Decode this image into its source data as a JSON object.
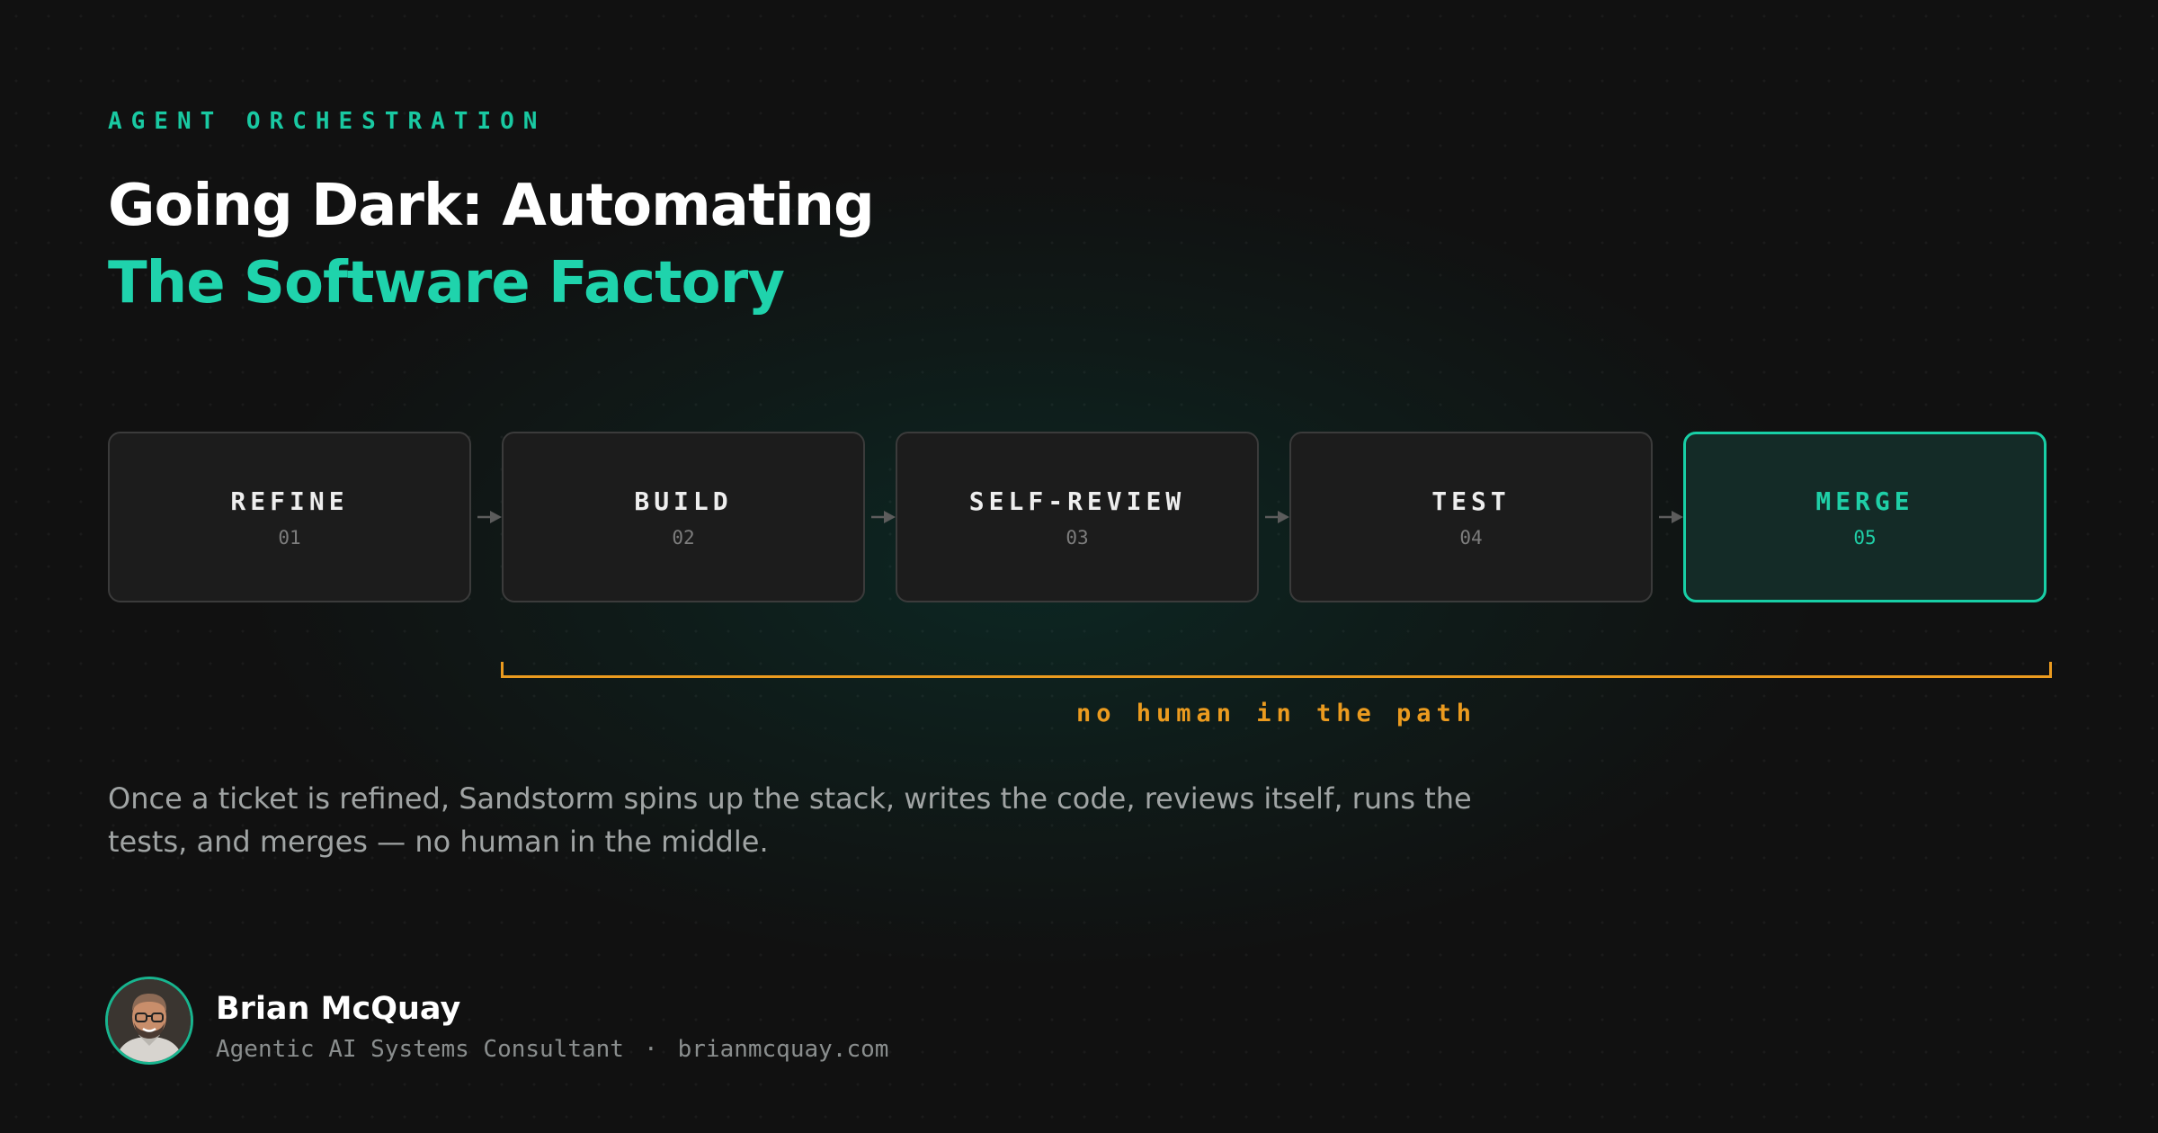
{
  "eyebrow": "AGENT ORCHESTRATION",
  "title": {
    "line1": "Going Dark: Automating",
    "line2": "The Software Factory"
  },
  "pipeline": {
    "stages": [
      {
        "label": "REFINE",
        "number": "01"
      },
      {
        "label": "BUILD",
        "number": "02"
      },
      {
        "label": "SELF-REVIEW",
        "number": "03"
      },
      {
        "label": "TEST",
        "number": "04"
      },
      {
        "label": "MERGE",
        "number": "05",
        "highlighted": true
      }
    ],
    "bracket_label": "no human in the path"
  },
  "description": "Once a ticket is refined, Sandstorm spins up the stack, writes the code, reviews itself, runs the tests, and merges — no human in the middle.",
  "author": {
    "name": "Brian McQuay",
    "role": "Agentic AI Systems Consultant",
    "separator": "·",
    "website": "brianmcquay.com",
    "avatar_icon": "person-avatar-photo"
  },
  "colors": {
    "accent": "#1fd3ac",
    "bracket": "#eb9b1f",
    "background": "#111111",
    "card": "#1c1c1c",
    "card_border": "#3b3b3b",
    "active_card": "#142b27"
  }
}
